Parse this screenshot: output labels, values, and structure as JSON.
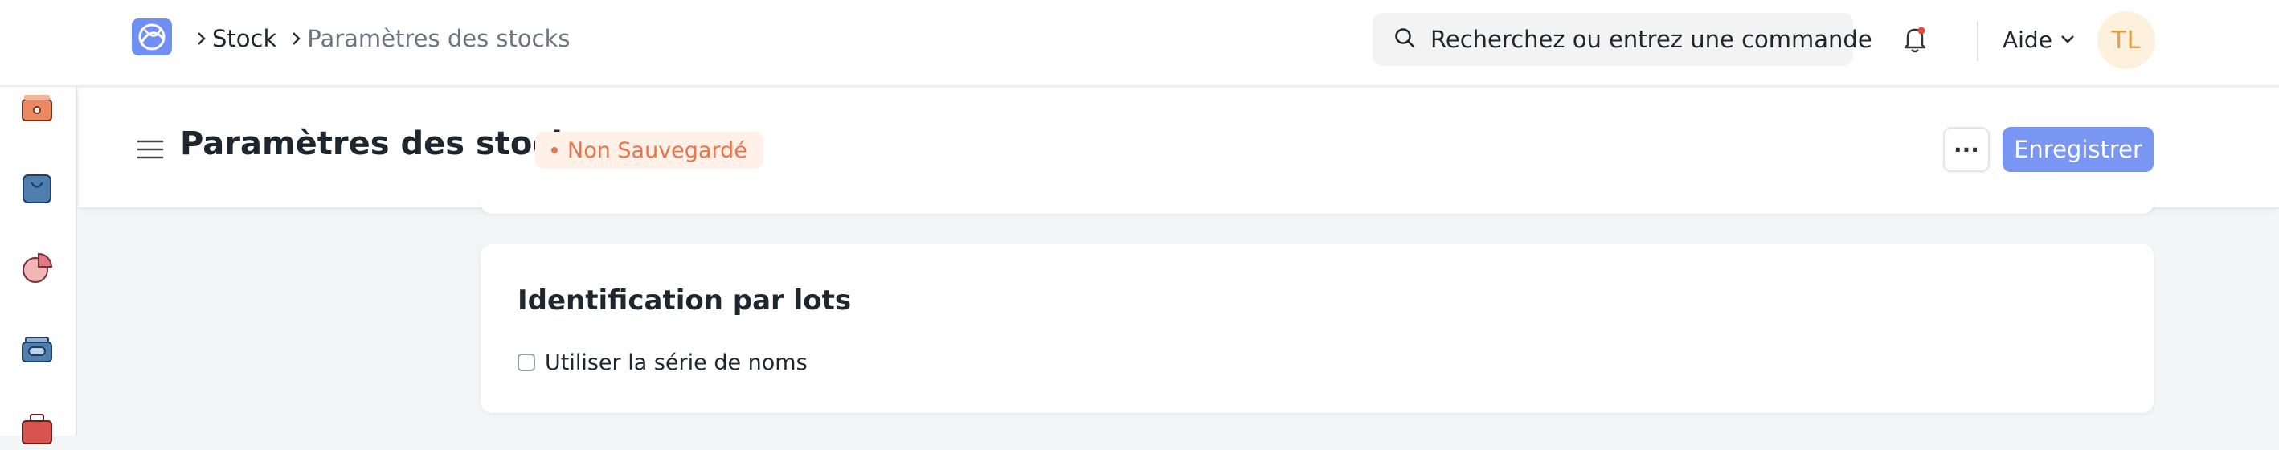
{
  "navbar": {
    "breadcrumb": [
      {
        "label": "Stock"
      },
      {
        "label": "Paramètres des stocks"
      }
    ],
    "search_placeholder": "Recherchez ou entrez une commande",
    "help_label": "Aide",
    "avatar_initials": "TL"
  },
  "sidebar": {
    "icons": [
      "wallet-icon",
      "shopping-bag-icon",
      "pie-chart-icon",
      "stack-icon",
      "toolbox-icon"
    ]
  },
  "page": {
    "title": "Paramètres des stocks",
    "status": "Non Sauvegardé",
    "more_label": "···",
    "save_label": "Enregistrer"
  },
  "section": {
    "title": "Identification par lots",
    "checkbox_label": "Utiliser la série de noms",
    "checkbox_checked": false
  },
  "colors": {
    "primary": "#7896f2",
    "status": "#e8754c",
    "avatar_bg": "#fdf0dc",
    "avatar_fg": "#e0a043"
  }
}
